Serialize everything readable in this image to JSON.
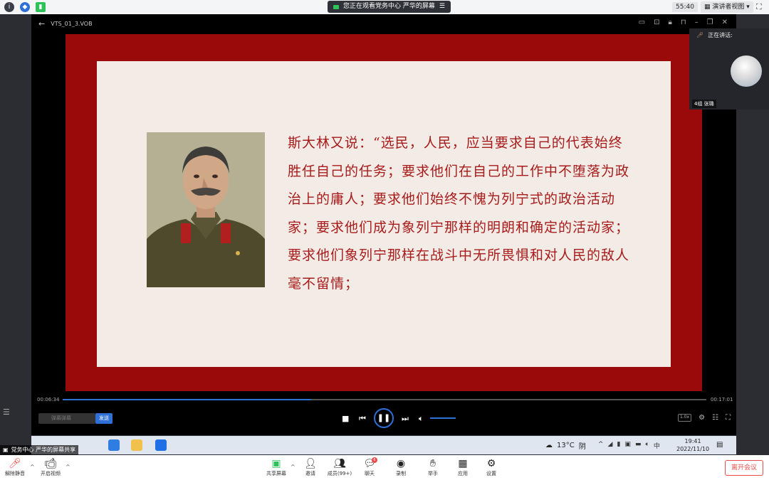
{
  "topbar": {
    "share_notice": "您正在观看党务中心 严华的屏幕",
    "timer": "55:40",
    "view_mode": "演讲者视图",
    "info_icon": "info-icon",
    "shield_icon": "shield-icon",
    "signal_icon": "signal-bars-icon"
  },
  "player": {
    "file_name": "VTS_01_3.VOB",
    "time_current": "00:06:34",
    "time_total": "00:17:01",
    "progress": 0.386,
    "volume": 0.6,
    "danmu_placeholder": "弹幕弹幕",
    "send_label": "发送",
    "speed_label": "1.0x"
  },
  "slide": {
    "quote": "斯大林又说：“选民，人民，应当要求自己的代表始终胜任自己的任务；要求他们在自己的工作中不堕落为政治上的庸人；要求他们始终不愧为列宁式的政治活动家；要求他们成为象列宁那样的明朗和确定的活动家；要求他们象列宁那样在战斗中无所畏惧和对人民的敌人毫不留情；"
  },
  "speaker_panel": {
    "status": "正在讲话:",
    "name": "4组 张璐"
  },
  "taskbar": {
    "weather_temp": "13°C",
    "weather_desc": "阴",
    "ime": "中",
    "time": "19:41",
    "date": "2022/11/10"
  },
  "share_label": "党务中心 严华的屏幕共享",
  "bottombar": {
    "unmute": "解除静音",
    "start_video": "开启视频",
    "share_screen": "共享屏幕",
    "invite": "邀请",
    "members": "成员(99+)",
    "chat": "聊天",
    "chat_badge": "6",
    "record": "录制",
    "raise_hand": "举手",
    "apps": "应用",
    "settings": "设置",
    "leave": "离开会议"
  }
}
